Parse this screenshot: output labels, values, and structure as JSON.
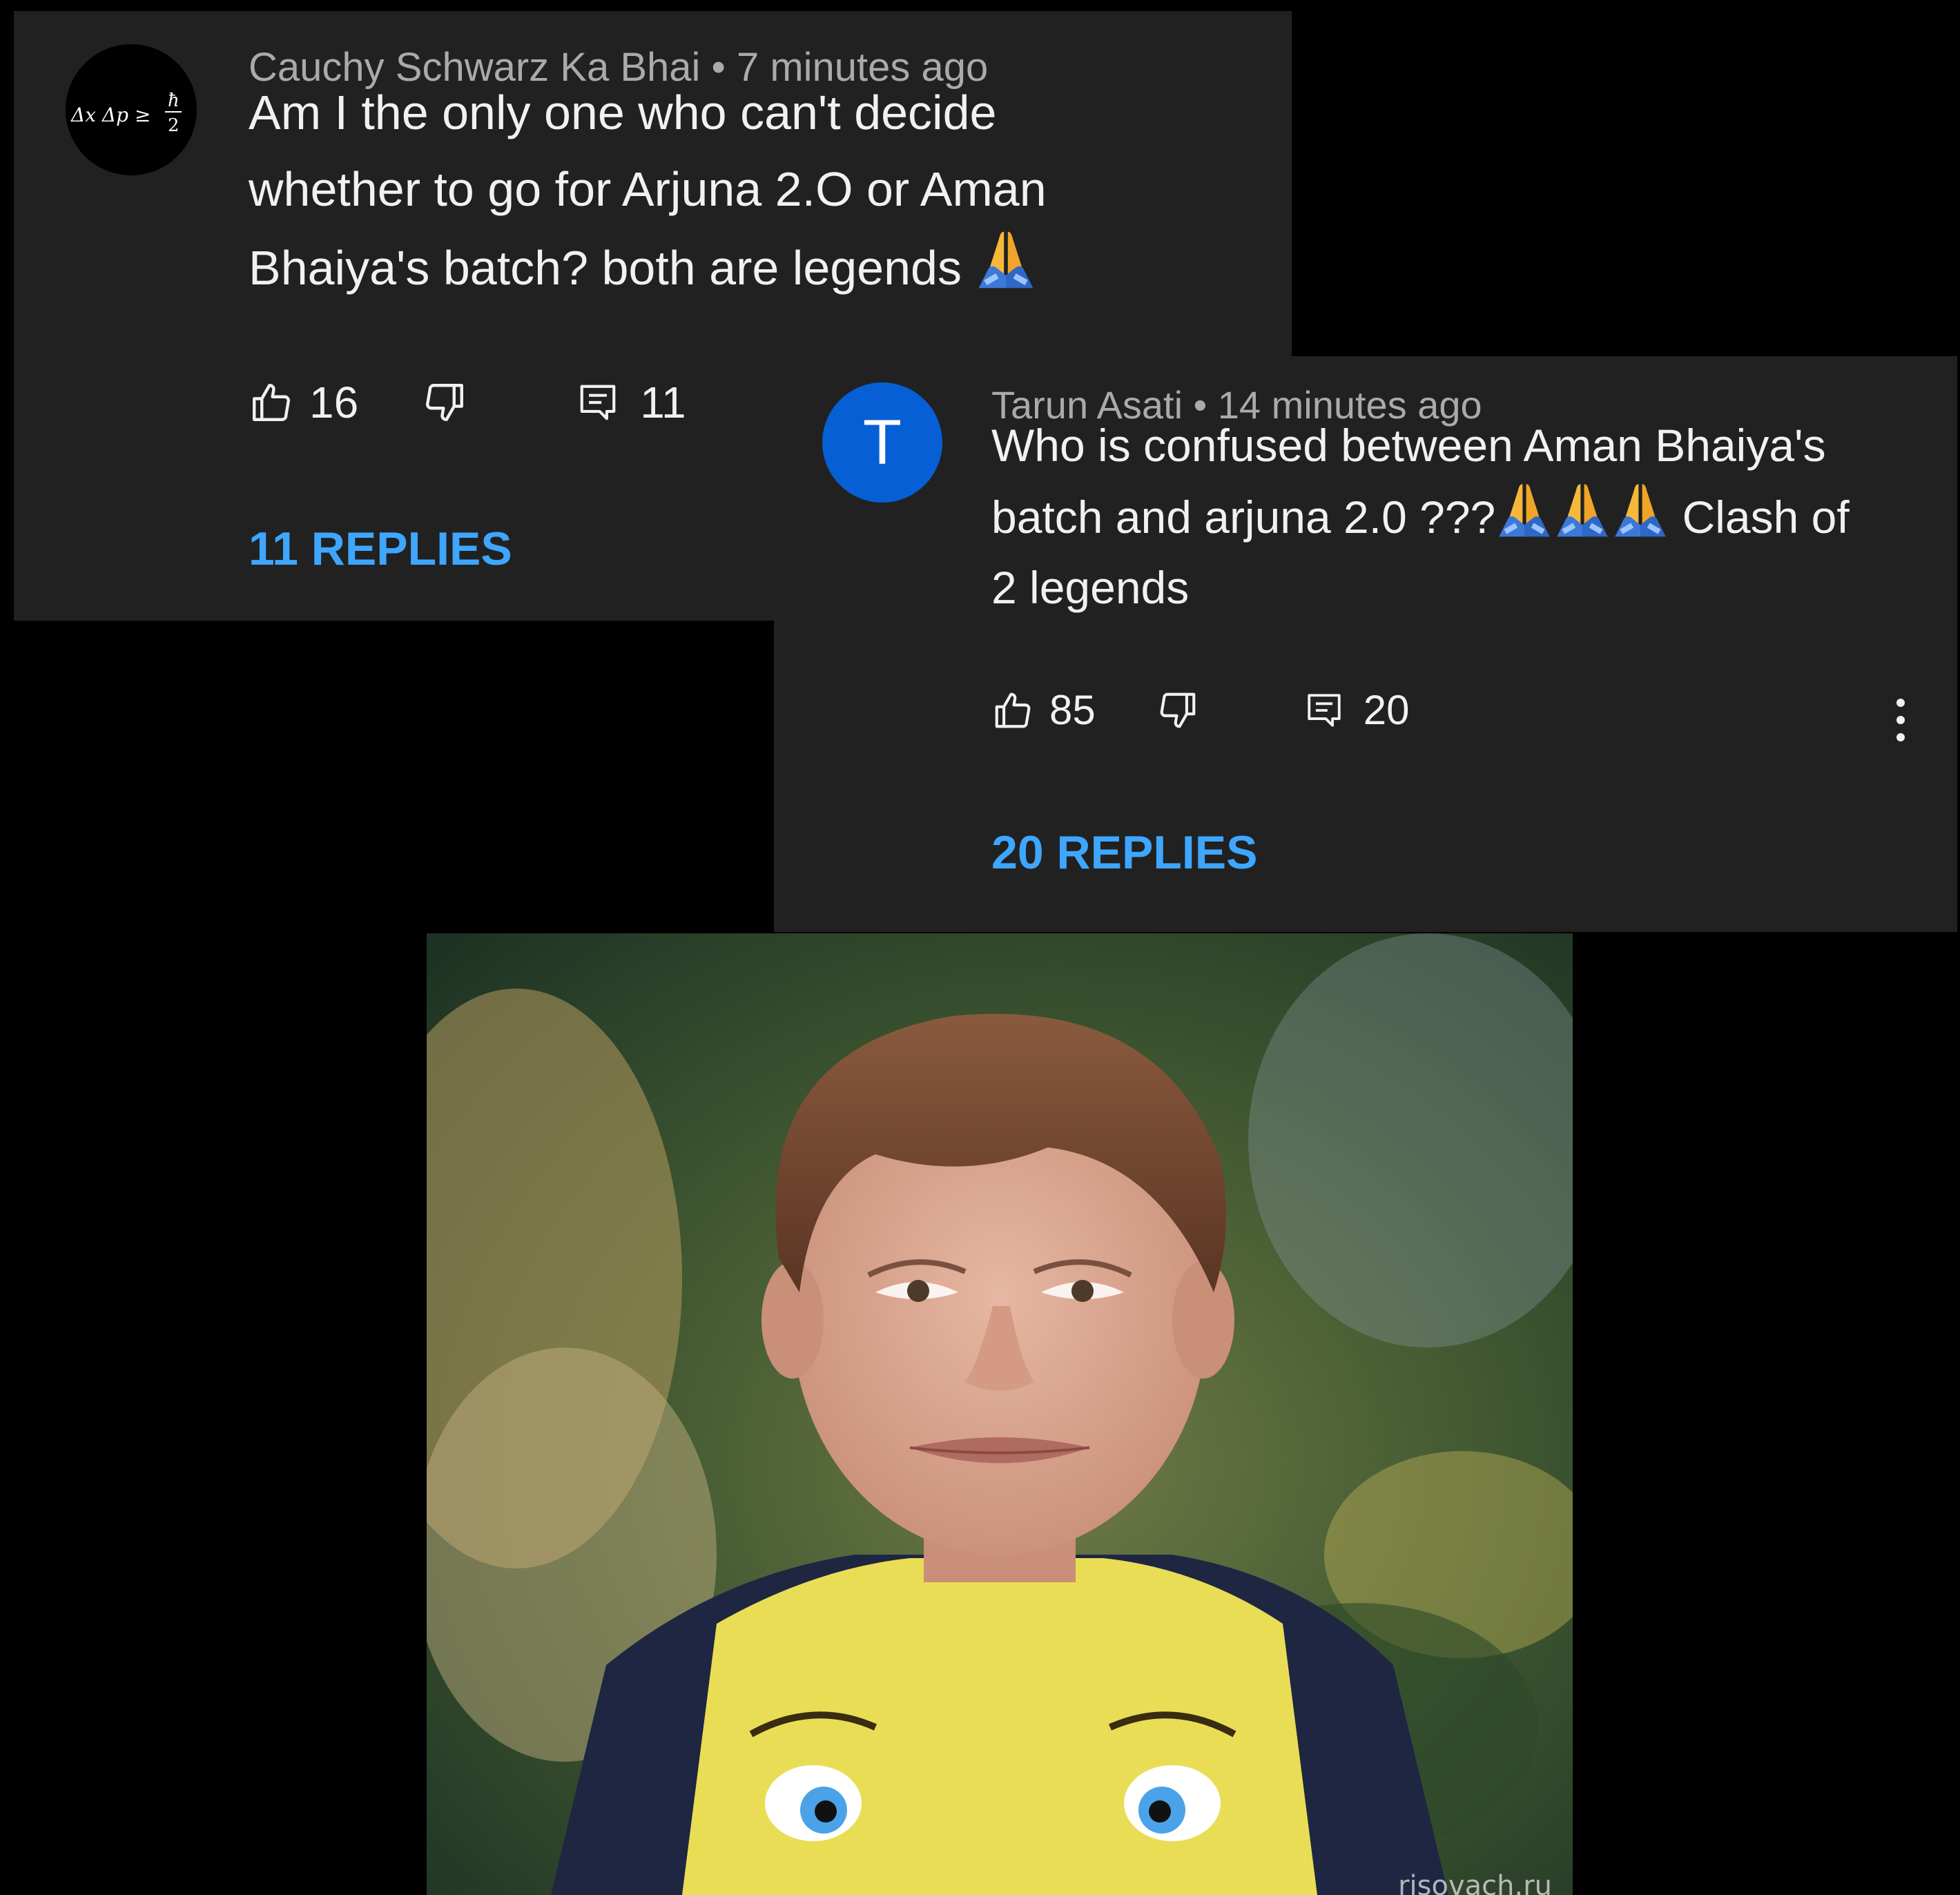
{
  "comments": [
    {
      "author": "Cauchy Schwarz Ka Bhai",
      "time": "7 minutes ago",
      "meta": "Cauchy Schwarz Ka Bhai • 7 minutes ago",
      "text": "Am I the only one who can't decide\nwhether to go for Arjuna 2.O or Aman\nBhaiya's batch? both are legends",
      "avatar_formula": "Δx Δp ≥ ħ/2",
      "likes": "16",
      "reply_count": "11",
      "replies_label": "11 REPLIES"
    },
    {
      "author": "Tarun Asati",
      "time": "14 minutes ago",
      "meta": "Tarun Asati • 14 minutes ago",
      "text_part1": "Who is confused between Aman Bhaiya's\nbatch and arjuna 2.0 ???",
      "text_part2": " Clash of\n2 legends",
      "avatar_letter": "T",
      "likes": "85",
      "reply_count": "20",
      "replies_label": "20 REPLIES"
    }
  ],
  "icons": [
    "like-icon",
    "dislike-icon",
    "reply-icon",
    "more-vert-icon",
    "folded-hands-emoji"
  ],
  "colors": {
    "card": "#212121",
    "background": "#000000",
    "link": "#3ea6ff",
    "avatar2": "#065fd4",
    "meta": "#aaaaaa"
  },
  "image": {
    "watermark": "risovach.ru"
  }
}
